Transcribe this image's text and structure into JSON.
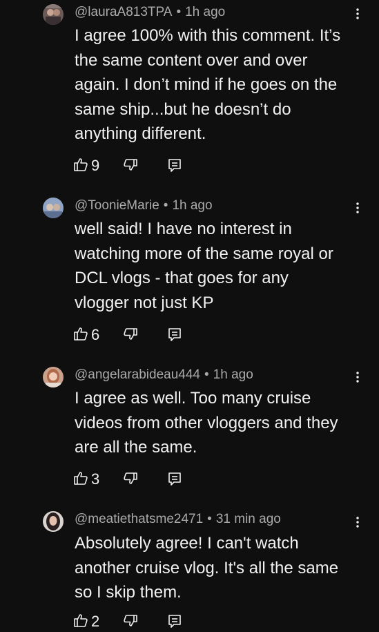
{
  "comments": [
    {
      "author": "@lauraA813TPA",
      "time": "1h ago",
      "lines": [
        "I agree 100% with this comment. It’s",
        "the same content over and over",
        "again. I don’t mind if he goes on the",
        "same ship...but he doesn’t do",
        "anything different."
      ],
      "likes": "9"
    },
    {
      "author": "@ToonieMarie",
      "time": "1h ago",
      "lines": [
        "well said! I have no interest in",
        "watching more of the same royal or",
        "DCL vlogs - that goes for any",
        "vlogger not just KP"
      ],
      "likes": "6"
    },
    {
      "author": "@angelarabideau444",
      "time": "1h ago",
      "lines": [
        "I agree as well.  Too many cruise",
        "videos from other vloggers and they",
        "are all the same."
      ],
      "likes": "3"
    },
    {
      "author": "@meatiethatsme2471",
      "time": "31 min ago",
      "lines": [
        "Absolutely agree! I can't watch",
        "another cruise vlog. It's all the same",
        "so I skip them."
      ],
      "likes": "2"
    }
  ],
  "separator": "•",
  "colors": {
    "background": "#0f0f0f",
    "text": "#f1f1f1",
    "meta": "#aaaaaa"
  },
  "icons": {
    "like": "thumb-up-icon",
    "dislike": "thumb-down-icon",
    "reply": "reply-icon",
    "menu": "more-vertical-icon"
  }
}
